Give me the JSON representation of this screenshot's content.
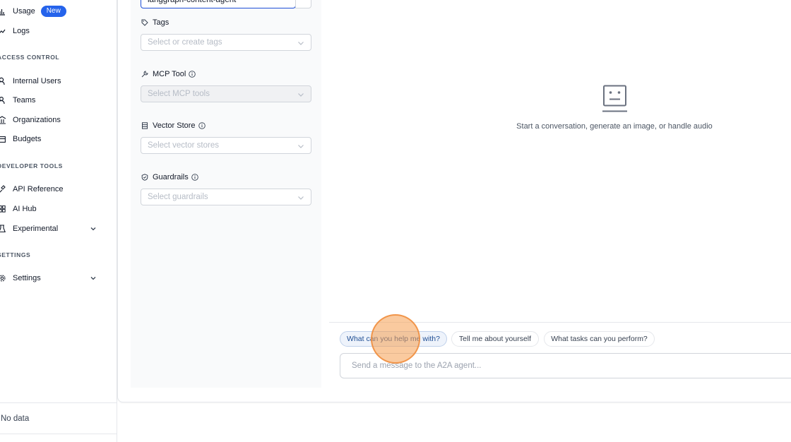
{
  "sidebar": {
    "items": [
      {
        "label": "Usage",
        "icon": "bar-chart-icon",
        "badge": "New"
      },
      {
        "label": "Logs",
        "icon": "line-chart-icon"
      }
    ],
    "sections": [
      {
        "title": "ACCESS CONTROL",
        "items": [
          {
            "label": "Internal Users",
            "icon": "user-icon"
          },
          {
            "label": "Teams",
            "icon": "team-icon"
          },
          {
            "label": "Organizations",
            "icon": "bank-icon"
          },
          {
            "label": "Budgets",
            "icon": "wallet-icon"
          }
        ]
      },
      {
        "title": "DEVELOPER TOOLS",
        "items": [
          {
            "label": "API Reference",
            "icon": "api-icon"
          },
          {
            "label": "AI Hub",
            "icon": "grid-icon"
          },
          {
            "label": "Experimental",
            "icon": "flask-icon"
          }
        ]
      },
      {
        "title": "SETTINGS",
        "items": [
          {
            "label": "Settings",
            "icon": "gear-icon"
          }
        ]
      }
    ],
    "footer_text": "No data"
  },
  "config": {
    "agent_value": "langgraph-content-agent",
    "tags_label": "Tags",
    "tags_placeholder": "Select or create tags",
    "mcp_label": "MCP Tool",
    "mcp_placeholder": "Select MCP tools",
    "vector_label": "Vector Store",
    "vector_placeholder": "Select vector stores",
    "guardrails_label": "Guardrails",
    "guardrails_placeholder": "Select guardrails"
  },
  "chat": {
    "empty_text": "Start a conversation, generate an image, or handle audio",
    "suggestions": [
      "What can you help me with?",
      "Tell me about yourself",
      "What tasks can you perform?"
    ],
    "input_placeholder": "Send a message to the A2A agent..."
  },
  "colors": {
    "accent": "#2563eb",
    "panel_bg": "#f9fafb",
    "click_marker": "#f59e50"
  }
}
